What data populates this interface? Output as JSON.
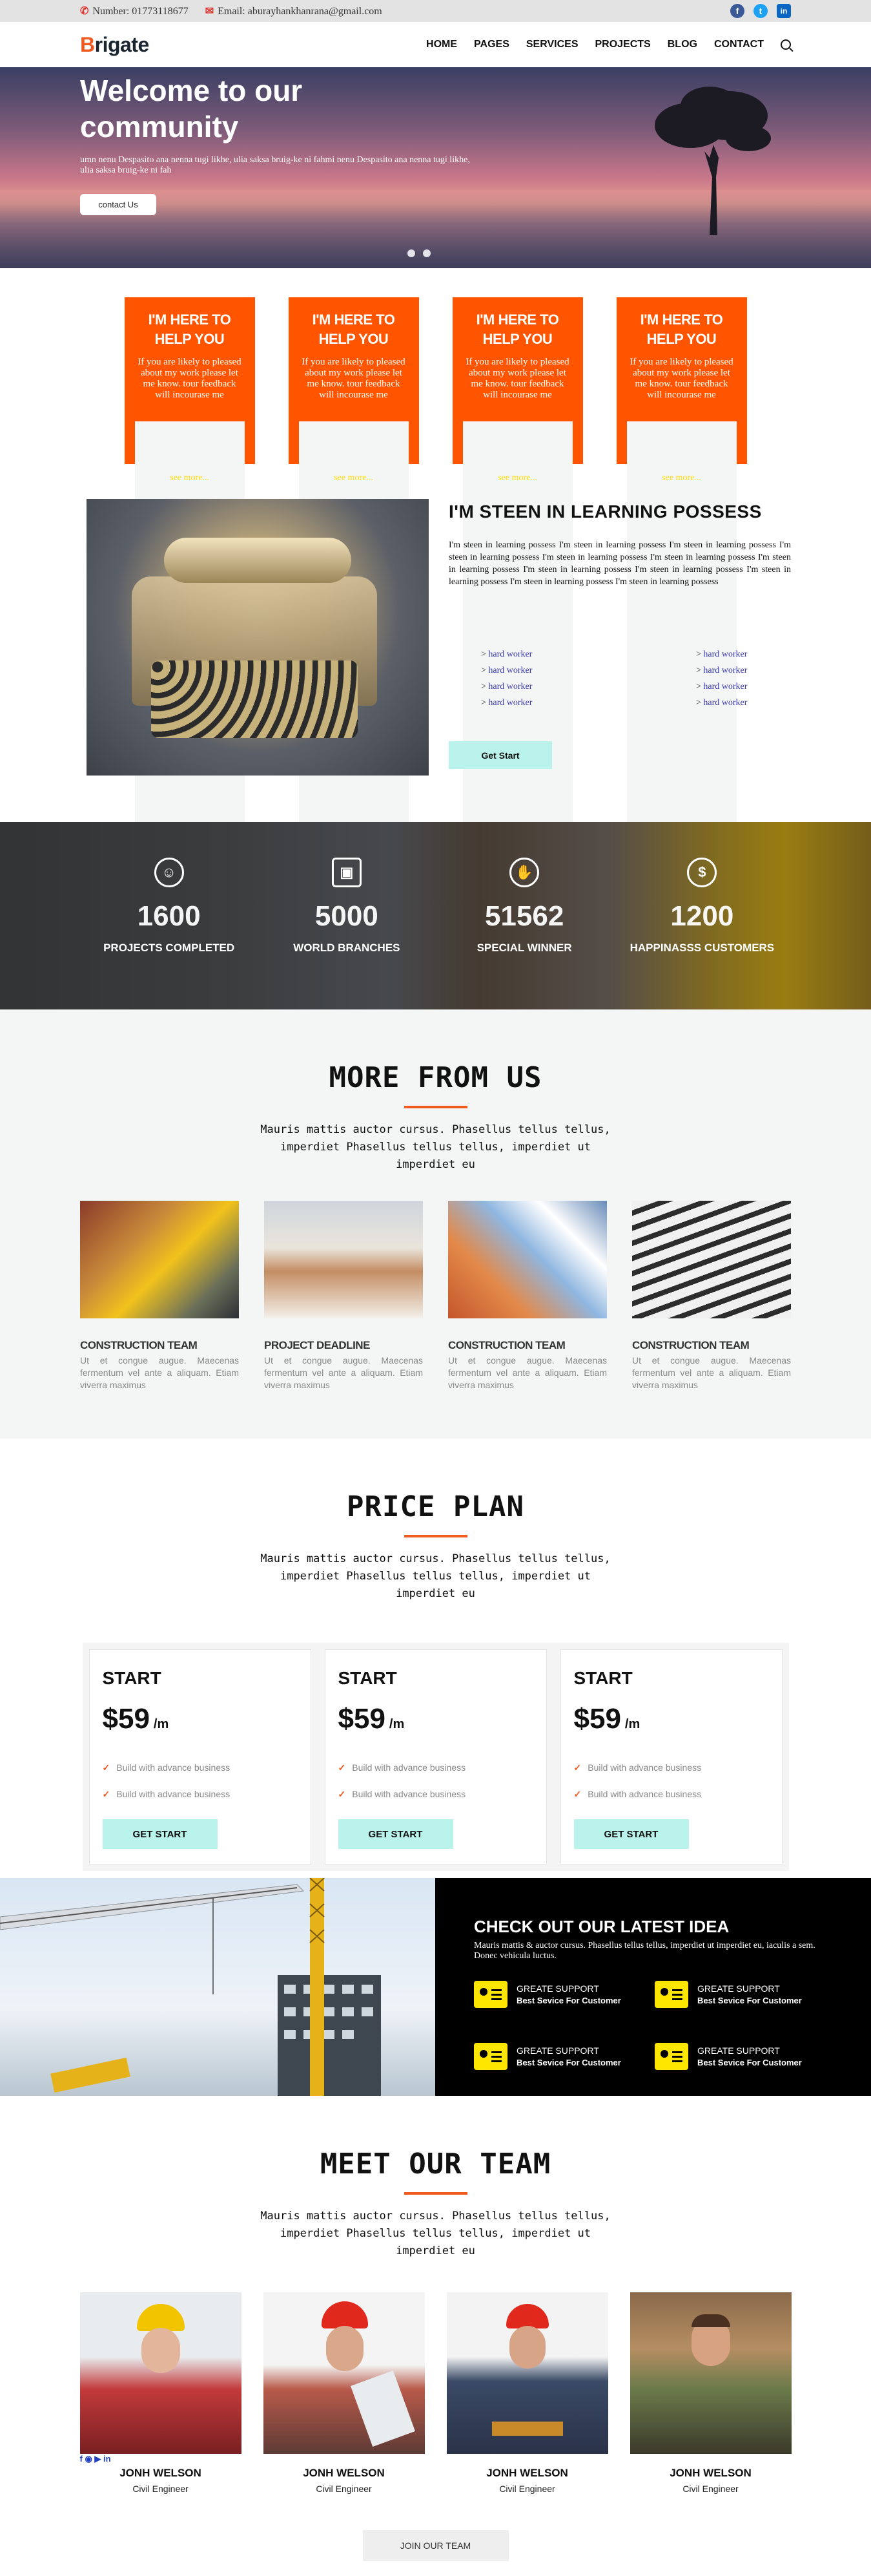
{
  "topbar": {
    "phone": "Number: 01773118677",
    "email": "Email: aburayhankhanrana@gmail.com",
    "social": [
      "f",
      "t",
      "in"
    ],
    "colors": {
      "facebook": "#3b5998",
      "twitter": "#1da1f2",
      "linkedin": "#0a66c2"
    }
  },
  "nav": {
    "logo_first": "B",
    "logo_rest": "rigate",
    "items": [
      "HOME",
      "PAGES",
      "SERVICES",
      "PROJECTS",
      "BLOG",
      "CONTACT"
    ]
  },
  "hero": {
    "title": "Welcome to our community",
    "text": "umn nenu Despasito ana nenna tugi likhe, ulia saksa bruig-ke ni fahmi nenu Despasito ana nenna tugi likhe, ulia saksa bruig-ke ni fah",
    "button": "contact Us"
  },
  "help_cards": [
    {
      "title": "I'M HERE TO HELP YOU",
      "text": "If you are likely to pleased about my work please let me know. tour feedback will incourase me",
      "more": "see more..."
    },
    {
      "title": "I'M HERE TO HELP YOU",
      "text": "If you are likely to pleased about my work please let me know. tour feedback will incourase me",
      "more": "see more..."
    },
    {
      "title": "I'M HERE TO HELP YOU",
      "text": "If you are likely to pleased about my work please let me know. tour feedback will incourase me",
      "more": "see more..."
    },
    {
      "title": "I'M HERE TO HELP YOU",
      "text": "If you are likely to pleased about my work please let me know. tour feedback will incourase me",
      "more": "see more..."
    }
  ],
  "about": {
    "title": "I'M STEEN IN LEARNING POSSESS",
    "text": "I'm steen in learning possess I'm steen in learning possess I'm steen in learning possess I'm steen in learning possess I'm steen in learning possess I'm steen in learning possess I'm steen in learning possess I'm steen in learning possess I'm steen in learning possess I'm steen in learning possess I'm steen in learning possess I'm steen in learning possess",
    "list_left": [
      "hard worker",
      "hard worker",
      "hard worker",
      "hard worker"
    ],
    "list_right": [
      "hard worker",
      "hard worker",
      "hard worker",
      "hard worker"
    ],
    "button": "Get Start"
  },
  "stats": [
    {
      "icon": "☺",
      "num": "1600",
      "label": "PROJECTS COMPLETED"
    },
    {
      "icon": "▣",
      "num": "5000",
      "label": "WORLD BRANCHES"
    },
    {
      "icon": "✋",
      "num": "51562",
      "label": "SPECIAL WINNER"
    },
    {
      "icon": "$",
      "num": "1200",
      "label": "HAPPINASSS CUSTOMERS"
    }
  ],
  "more": {
    "title": "MORE FROM US",
    "subtitle": "Mauris mattis auctor cursus. Phasellus tellus tellus, imperdiet Phasellus tellus tellus, imperdiet ut imperdiet eu",
    "cards": [
      {
        "title": "CONSTRUCTION TEAM",
        "text": "Ut et congue augue. Maecenas fermentum vel ante a aliquam. Etiam viverra maximus"
      },
      {
        "title": "PROJECT DEADLINE",
        "text": "Ut et congue augue. Maecenas fermentum vel ante a aliquam. Etiam viverra maximus"
      },
      {
        "title": "CONSTRUCTION TEAM",
        "text": "Ut et congue augue. Maecenas fermentum vel ante a aliquam. Etiam viverra maximus"
      },
      {
        "title": "CONSTRUCTION TEAM",
        "text": "Ut et congue augue. Maecenas fermentum vel ante a aliquam. Etiam viverra maximus"
      }
    ]
  },
  "pricing": {
    "title": "PRICE PLAN",
    "subtitle": "Mauris mattis auctor cursus. Phasellus tellus tellus, imperdiet Phasellus tellus tellus, imperdiet ut imperdiet eu",
    "plans": [
      {
        "name": "START",
        "price": "$59",
        "per": "/m",
        "features": [
          "Build with advance business",
          "Build with advance business"
        ],
        "button": "GET START"
      },
      {
        "name": "START",
        "price": "$59",
        "per": "/m",
        "features": [
          "Build with advance business",
          "Build with advance business"
        ],
        "button": "GET START"
      },
      {
        "name": "START",
        "price": "$59",
        "per": "/m",
        "features": [
          "Build with advance business",
          "Build with advance business"
        ],
        "button": "GET START"
      }
    ]
  },
  "idea": {
    "title": "CHECK OUT OUR LATEST IDEA",
    "text": "Mauris mattis & auctor cursus. Phasellus tellus tellus, imperdiet ut imperdiet eu, iaculis a sem. Donec vehicula luctus.",
    "features": [
      {
        "t1": "GREATE SUPPORT",
        "t2": "Best Sevice For Customer"
      },
      {
        "t1": "GREATE SUPPORT",
        "t2": "Best Sevice For Customer"
      },
      {
        "t1": "GREATE SUPPORT",
        "t2": "Best Sevice For Customer"
      },
      {
        "t1": "GREATE SUPPORT",
        "t2": "Best Sevice For Customer"
      }
    ]
  },
  "team": {
    "title": "MEET OUR TEAM",
    "subtitle": "Mauris mattis auctor cursus. Phasellus tellus tellus, imperdiet Phasellus tellus tellus, imperdiet ut imperdiet eu",
    "social": "f ◉ ▶ in",
    "members": [
      {
        "name": "JONH WELSON",
        "role": "Civil Engineer"
      },
      {
        "name": "JONH WELSON",
        "role": "Civil Engineer"
      },
      {
        "name": "JONH WELSON",
        "role": "Civil Engineer"
      },
      {
        "name": "JONH WELSON",
        "role": "Civil Engineer"
      }
    ],
    "button": "JOIN OUR TEAM"
  }
}
